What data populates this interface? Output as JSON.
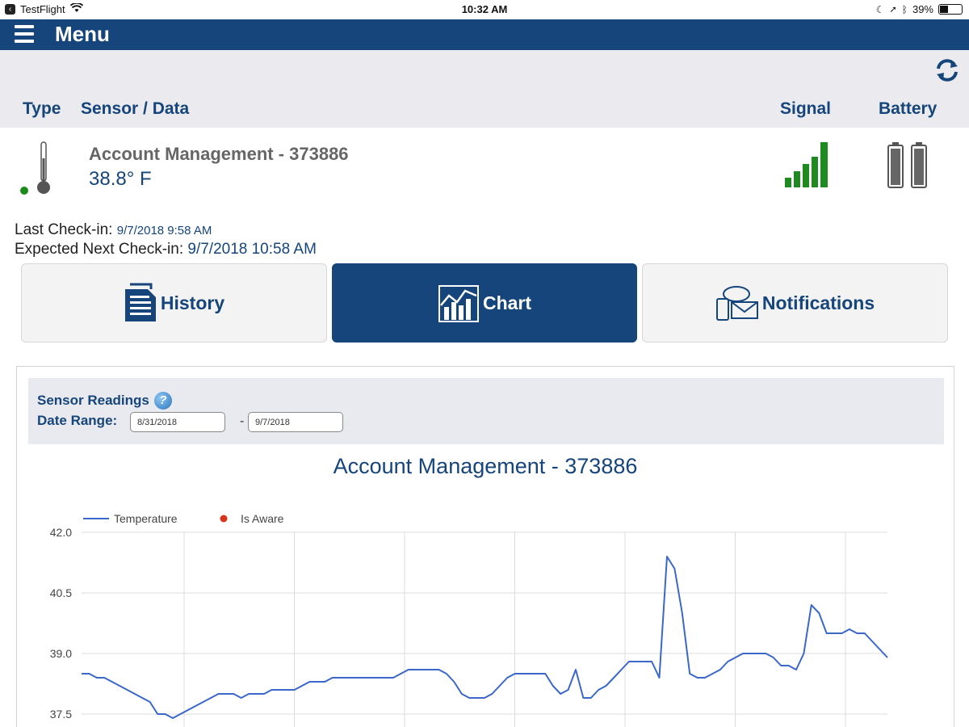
{
  "status_bar": {
    "app": "TestFlight",
    "time": "10:32 AM",
    "battery_percent": "39%",
    "battery_level": 0.39
  },
  "nav": {
    "title": "Menu"
  },
  "table_header": {
    "type": "Type",
    "sensor": "Sensor / Data",
    "signal": "Signal",
    "battery": "Battery"
  },
  "sensor": {
    "name": "Account Management - 373886",
    "value": "38.8° F",
    "status_color": "#1a8a1a",
    "signal_bars": 5,
    "battery_cells": 2
  },
  "checkin": {
    "last_label": "Last Check-in:",
    "last_value": "9/7/2018 9:58 AM",
    "next_label": "Expected Next Check-in:",
    "next_value": "9/7/2018 10:58 AM"
  },
  "tabs": [
    {
      "label": "History",
      "icon": "document-icon",
      "active": false
    },
    {
      "label": "Chart",
      "icon": "chart-icon",
      "active": true
    },
    {
      "label": "Notifications",
      "icon": "notifications-icon",
      "active": false
    }
  ],
  "readings": {
    "label": "Sensor Readings",
    "date_range_label": "Date Range:",
    "date_from": "8/31/2018",
    "date_to": "9/7/2018"
  },
  "colors": {
    "brand": "#15457a",
    "series": "#3a67c8",
    "aware": "#d9331c"
  },
  "chart_data": {
    "type": "line",
    "title": "Account Management - 373886",
    "legend": [
      {
        "name": "Temperature",
        "marker": "line",
        "color": "#3a67c8"
      },
      {
        "name": "Is Aware",
        "marker": "dot",
        "color": "#d9331c"
      }
    ],
    "legend_placement": "top-left",
    "y_ticks": [
      "42.0",
      "40.5",
      "39.0",
      "37.5"
    ],
    "ylim": [
      37.5,
      42.0
    ],
    "grid": true,
    "series": [
      {
        "name": "Temperature",
        "values": [
          38.5,
          38.5,
          38.4,
          38.4,
          38.3,
          38.2,
          38.1,
          38.0,
          37.9,
          37.8,
          37.5,
          37.5,
          37.4,
          37.5,
          37.6,
          37.7,
          37.8,
          37.9,
          38.0,
          38.0,
          38.0,
          37.9,
          38.0,
          38.0,
          38.0,
          38.1,
          38.1,
          38.1,
          38.1,
          38.2,
          38.3,
          38.3,
          38.3,
          38.4,
          38.4,
          38.4,
          38.4,
          38.4,
          38.4,
          38.4,
          38.4,
          38.4,
          38.5,
          38.6,
          38.6,
          38.6,
          38.6,
          38.6,
          38.5,
          38.3,
          38.0,
          37.9,
          37.9,
          37.9,
          38.0,
          38.2,
          38.4,
          38.5,
          38.5,
          38.5,
          38.5,
          38.5,
          38.2,
          38.0,
          38.1,
          38.6,
          37.9,
          37.9,
          38.1,
          38.2,
          38.4,
          38.6,
          38.8,
          38.8,
          38.8,
          38.8,
          38.4,
          41.4,
          41.1,
          40.0,
          38.5,
          38.4,
          38.4,
          38.5,
          38.6,
          38.8,
          38.9,
          39.0,
          39.0,
          39.0,
          39.0,
          38.9,
          38.7,
          38.7,
          38.6,
          39.0,
          40.2,
          40.0,
          39.5,
          39.5,
          39.5,
          39.6,
          39.5,
          39.5,
          39.3,
          39.1,
          38.9
        ]
      }
    ]
  }
}
